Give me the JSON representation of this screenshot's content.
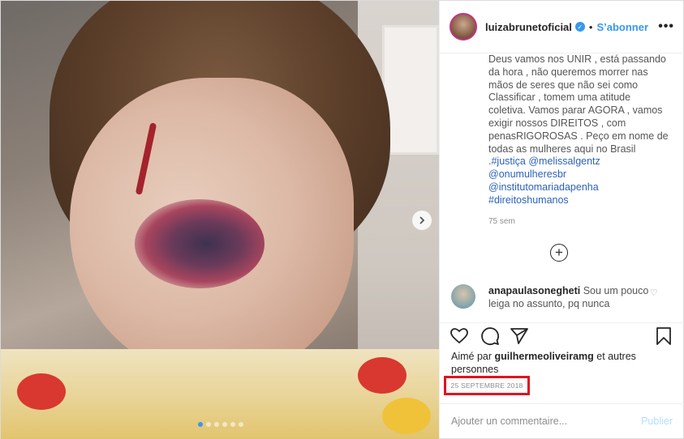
{
  "post": {
    "username": "luizabrunetoficial",
    "follow_label": "S’abonner",
    "separator": "•",
    "more_label": "•••",
    "carousel": {
      "slide_count": 6,
      "active_index": 0
    }
  },
  "caption": {
    "text": "Deus vamos nos UNIR , está passando da hora , não queremos morrer nas mãos de seres que não sei como Classificar , tomem uma atitude coletiva. Vamos parar AGORA , vamos exigir nossos DIREITOS , com penasRIGOROSAS . Peço em nome de todas as mulheres aqui no Brasil .",
    "tags": [
      "#justiça",
      "@melissalgentz",
      "@onumulheresbr",
      "@institutomariadapenha",
      "#direitoshumanos"
    ],
    "time": "75 sem"
  },
  "load_more_label": "+",
  "comment": {
    "username": "anapaulasonegheti",
    "text": "Sou um pouco leiga no assunto, pq nunca"
  },
  "likes": {
    "prefix": "Aimé par",
    "user": "guilhermeoliveiramg",
    "suffix": "et autres personnes"
  },
  "date": "25 SEPTEMBRE 2018",
  "add_comment": {
    "placeholder": "Ajouter un commentaire...",
    "publish_label": "Publier"
  },
  "colors": {
    "accent": "#3897f0",
    "highlight_box": "#e0141e",
    "link": "#2c62b8"
  },
  "icons": [
    "heart-icon",
    "comment-icon",
    "share-icon",
    "bookmark-icon",
    "verified-icon",
    "chevron-right-icon",
    "plus-circle-icon"
  ]
}
